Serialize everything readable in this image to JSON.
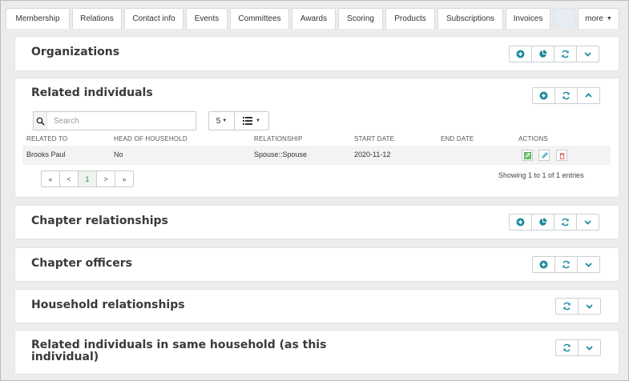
{
  "tabs": [
    {
      "label": "Membership"
    },
    {
      "label": "Relations"
    },
    {
      "label": "Contact info"
    },
    {
      "label": "Events"
    },
    {
      "label": "Committees"
    },
    {
      "label": "Awards"
    },
    {
      "label": "Scoring"
    },
    {
      "label": "Products"
    },
    {
      "label": "Subscriptions"
    },
    {
      "label": "Invoices"
    },
    {
      "label": ""
    },
    {
      "label": "more"
    }
  ],
  "panels": {
    "organizations": {
      "title": "Organizations"
    },
    "related_individuals": {
      "title": "Related individuals"
    },
    "chapter_relationships": {
      "title": "Chapter relationships"
    },
    "chapter_officers": {
      "title": "Chapter officers"
    },
    "household_relationships": {
      "title": "Household relationships"
    },
    "same_household": {
      "title_line1": "Related individuals in same household (as this",
      "title_line2": "individual)"
    }
  },
  "table": {
    "search_placeholder": "Search",
    "page_size": "5",
    "columns": [
      "RELATED TO",
      "HEAD OF HOUSEHOLD",
      "RELATIONSHIP",
      "START DATE",
      "END DATE",
      "ACTIONS"
    ],
    "rows": [
      {
        "related_to": "Brooks Paul",
        "head_of_household": "No",
        "relationship": "Spouse::Spouse",
        "start_date": "2020-11-12",
        "end_date": ""
      }
    ],
    "pager": [
      "«",
      "<",
      "1",
      ">",
      "»"
    ],
    "info": "Showing 1 to 1 of 1 entries"
  },
  "icons": {
    "add": "plus-circle-icon",
    "chart": "pie-chart-icon",
    "refresh": "refresh-icon",
    "expand": "chevron-down-icon",
    "collapse": "chevron-up-icon",
    "search": "search-icon",
    "list": "list-icon",
    "view": "view-icon",
    "edit": "pencil-icon",
    "delete": "trash-icon"
  },
  "colors": {
    "accent": "#1b8aa0",
    "view": "#4caf50",
    "edit": "#3aa0b7",
    "delete": "#d9534f"
  }
}
